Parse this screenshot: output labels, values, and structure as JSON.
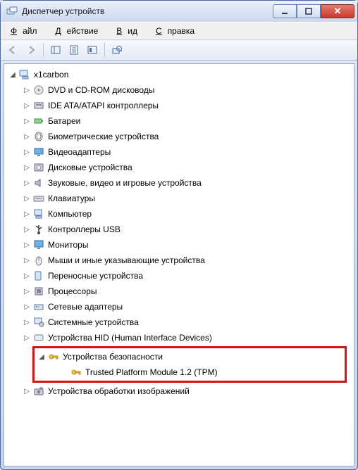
{
  "titlebar": {
    "title": "Диспетчер устройств"
  },
  "menubar": {
    "file": {
      "u": "Ф",
      "rest": "айл"
    },
    "action": {
      "u": "Д",
      "rest": "ействие"
    },
    "view": {
      "u": "В",
      "rest": "ид"
    },
    "help": {
      "u": "С",
      "rest": "правка"
    }
  },
  "tree": {
    "root": {
      "label": "x1carbon",
      "expanded": true
    },
    "categories": [
      {
        "id": "dvd",
        "label": "DVD и CD-ROM дисководы",
        "icon": "disc"
      },
      {
        "id": "ide",
        "label": "IDE ATA/ATAPI контроллеры",
        "icon": "ide"
      },
      {
        "id": "battery",
        "label": "Батареи",
        "icon": "battery"
      },
      {
        "id": "biometric",
        "label": "Биометрические устройства",
        "icon": "finger"
      },
      {
        "id": "display",
        "label": "Видеоадаптеры",
        "icon": "display"
      },
      {
        "id": "disk",
        "label": "Дисковые устройства",
        "icon": "hdd"
      },
      {
        "id": "sound",
        "label": "Звуковые, видео и игровые устройства",
        "icon": "sound"
      },
      {
        "id": "keyboard",
        "label": "Клавиатуры",
        "icon": "keyboard"
      },
      {
        "id": "computer",
        "label": "Компьютер",
        "icon": "computer"
      },
      {
        "id": "usb",
        "label": "Контроллеры USB",
        "icon": "usb"
      },
      {
        "id": "monitor",
        "label": "Мониторы",
        "icon": "monitor"
      },
      {
        "id": "mouse",
        "label": "Мыши и иные указывающие устройства",
        "icon": "mouse"
      },
      {
        "id": "portable",
        "label": "Переносные устройства",
        "icon": "portable"
      },
      {
        "id": "cpu",
        "label": "Процессоры",
        "icon": "cpu"
      },
      {
        "id": "network",
        "label": "Сетевые адаптеры",
        "icon": "network"
      },
      {
        "id": "system",
        "label": "Системные устройства",
        "icon": "system"
      },
      {
        "id": "hid",
        "label": "Устройства HID (Human Interface Devices)",
        "icon": "hid"
      }
    ],
    "security": {
      "label": "Устройства безопасности",
      "expanded": true,
      "children": [
        {
          "id": "tpm",
          "label": "Trusted Platform Module 1.2 (TPM)",
          "icon": "key"
        }
      ]
    },
    "after": [
      {
        "id": "imaging",
        "label": "Устройства обработки изображений",
        "icon": "camera"
      }
    ]
  }
}
